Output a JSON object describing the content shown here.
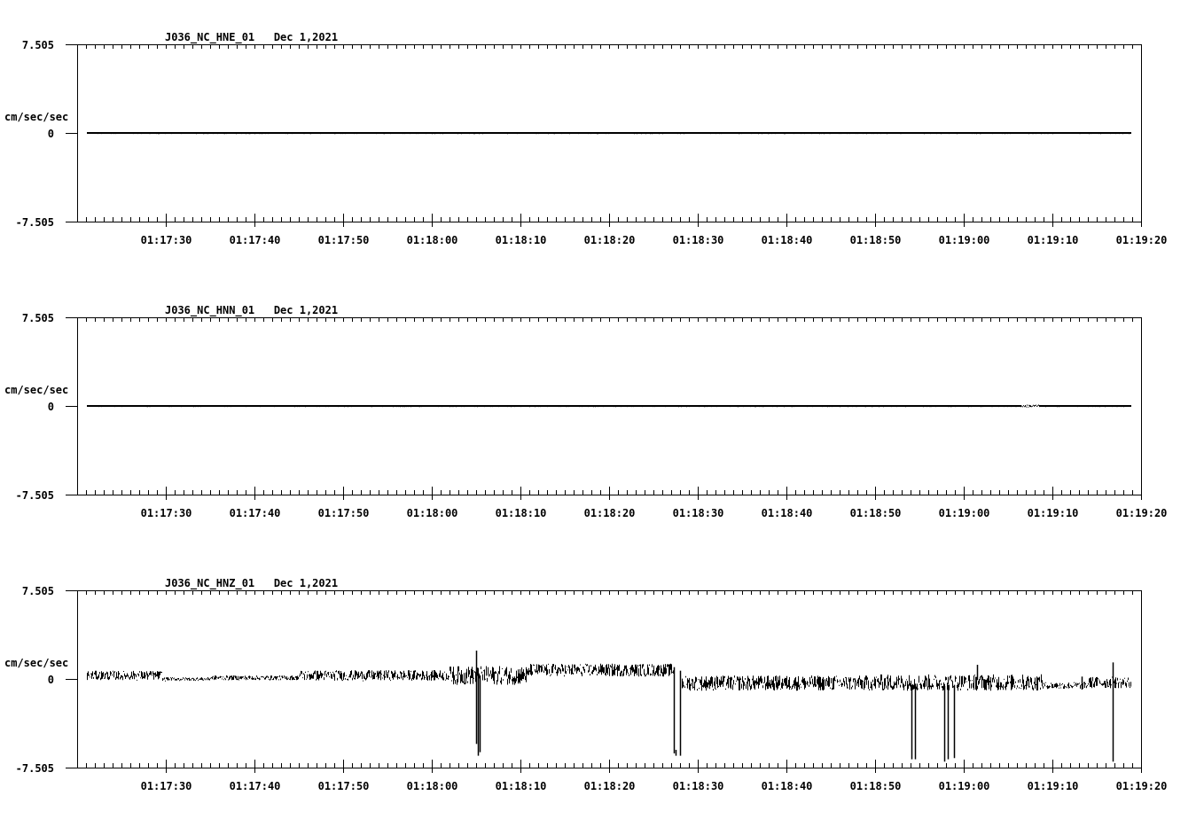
{
  "chart_data": [
    {
      "type": "line",
      "title": "J036_NC_HNE_01   Dec 1,2021",
      "ylabel": "cm/sec/sec",
      "ylim": [
        -7.505,
        7.505
      ],
      "yticks": [
        "7.505",
        "0",
        "-7.505"
      ],
      "xlim_seconds": [
        3440.0,
        3560.0
      ],
      "x_tick_labels": [
        "01:17:30",
        "01:17:40",
        "01:17:50",
        "01:18:00",
        "01:18:10",
        "01:18:20",
        "01:18:30",
        "01:18:40",
        "01:18:50",
        "01:19:00",
        "01:19:10",
        "01:19:20"
      ],
      "x_tick_seconds": [
        3450,
        3460,
        3470,
        3480,
        3490,
        3500,
        3510,
        3520,
        3530,
        3540,
        3550,
        3560
      ],
      "segments": [
        {
          "t": [
            3441.1,
            3558.9
          ],
          "level": 0.0,
          "noise": 0.02
        }
      ],
      "spikes": [
        {
          "t": 3546.6,
          "min": -0.05,
          "max": 0.05
        }
      ]
    },
    {
      "type": "line",
      "title": "J036_NC_HNN_01   Dec 1,2021",
      "ylabel": "cm/sec/sec",
      "ylim": [
        -7.505,
        7.505
      ],
      "yticks": [
        "7.505",
        "0",
        "-7.505"
      ],
      "xlim_seconds": [
        3440.0,
        3560.0
      ],
      "x_tick_labels": [
        "01:17:30",
        "01:17:40",
        "01:17:50",
        "01:18:00",
        "01:18:10",
        "01:18:20",
        "01:18:30",
        "01:18:40",
        "01:18:50",
        "01:19:00",
        "01:19:10",
        "01:19:20"
      ],
      "x_tick_seconds": [
        3450,
        3460,
        3470,
        3480,
        3490,
        3500,
        3510,
        3520,
        3530,
        3540,
        3550,
        3560
      ],
      "segments": [
        {
          "t": [
            3441.1,
            3546.5
          ],
          "level": 0.0,
          "noise": 0.02
        },
        {
          "t": [
            3546.5,
            3548.5
          ],
          "level": 0.0,
          "noise": 0.12
        },
        {
          "t": [
            3548.5,
            3558.9
          ],
          "level": 0.0,
          "noise": 0.02
        }
      ],
      "spikes": []
    },
    {
      "type": "line",
      "title": "J036_NC_HNZ_01   Dec 1,2021",
      "ylabel": "cm/sec/sec",
      "ylim": [
        -7.505,
        7.505
      ],
      "yticks": [
        "7.505",
        "0",
        "-7.505"
      ],
      "xlim_seconds": [
        3440.0,
        3560.0
      ],
      "x_tick_labels": [
        "01:17:30",
        "01:17:40",
        "01:17:50",
        "01:18:00",
        "01:18:10",
        "01:18:20",
        "01:18:30",
        "01:18:40",
        "01:18:50",
        "01:19:00",
        "01:19:10",
        "01:19:20"
      ],
      "x_tick_seconds": [
        3450,
        3460,
        3470,
        3480,
        3490,
        3500,
        3510,
        3520,
        3530,
        3540,
        3550,
        3560
      ],
      "segments": [
        {
          "t": [
            3441.1,
            3449.6
          ],
          "level": 0.3,
          "noise": 0.4
        },
        {
          "t": [
            3449.6,
            3455.0
          ],
          "level": 0.0,
          "noise": 0.15
        },
        {
          "t": [
            3455.0,
            3465.0
          ],
          "level": 0.1,
          "noise": 0.2
        },
        {
          "t": [
            3465.0,
            3482.0
          ],
          "level": 0.3,
          "noise": 0.45
        },
        {
          "t": [
            3482.0,
            3491.0
          ],
          "level": 0.3,
          "noise": 0.8
        },
        {
          "t": [
            3491.0,
            3507.3
          ],
          "level": 0.75,
          "noise": 0.55
        },
        {
          "t": [
            3508.2,
            3530.0
          ],
          "level": -0.35,
          "noise": 0.65
        },
        {
          "t": [
            3530.0,
            3549.0
          ],
          "level": -0.3,
          "noise": 0.7
        },
        {
          "t": [
            3549.0,
            3554.0
          ],
          "level": -0.55,
          "noise": 0.3
        },
        {
          "t": [
            3554.0,
            3558.9
          ],
          "level": -0.3,
          "noise": 0.5
        }
      ],
      "spikes": [
        {
          "t": 3485.0,
          "min": -5.5,
          "max": 2.4
        },
        {
          "t": 3485.2,
          "min": -6.5,
          "max": 0.5
        },
        {
          "t": 3485.4,
          "min": -6.2,
          "max": 0.3
        },
        {
          "t": 3507.3,
          "min": -6.3,
          "max": 1.0
        },
        {
          "t": 3507.5,
          "min": -6.5,
          "max": -6.0
        },
        {
          "t": 3508.0,
          "min": -6.5,
          "max": 0.7
        },
        {
          "t": 3534.1,
          "min": -6.8,
          "max": -0.5
        },
        {
          "t": 3534.5,
          "min": -6.8,
          "max": -0.4
        },
        {
          "t": 3537.8,
          "min": -7.0,
          "max": -0.6
        },
        {
          "t": 3538.2,
          "min": -6.8,
          "max": -0.5
        },
        {
          "t": 3538.9,
          "min": -6.7,
          "max": -0.5
        },
        {
          "t": 3541.5,
          "min": -0.1,
          "max": 1.2
        },
        {
          "t": 3553.3,
          "min": -0.9,
          "max": 0.2
        },
        {
          "t": 3556.8,
          "min": -7.0,
          "max": 1.4
        }
      ]
    }
  ]
}
